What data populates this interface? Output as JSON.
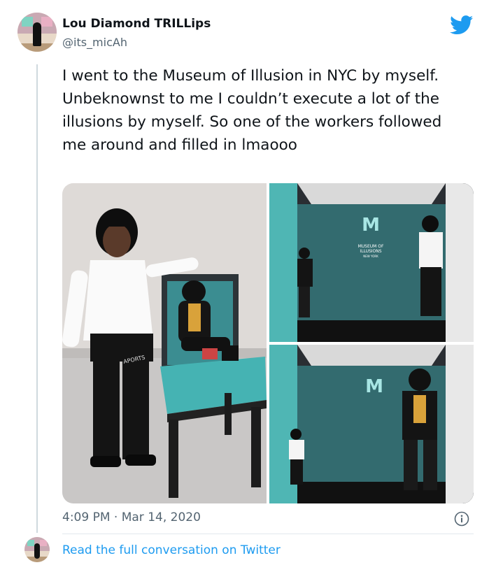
{
  "author": {
    "display_name": "Lou Diamond TRILLips",
    "handle": "@its_micAh"
  },
  "tweet": {
    "text": "I went to the Museum of Illusion in NYC by myself. Unbeknownst to me I couldn’t execute a lot of the illusions by myself. So one of the workers followed me around and filled in lmaooo",
    "time": "4:09 PM",
    "separator": "·",
    "date": "Mar 14, 2020"
  },
  "media": {
    "wall_sign_line1": "MUSEUM OF",
    "wall_sign_line2": "ILLUSIONS",
    "wall_sign_line3": "NEW YORK",
    "fanny_pack_text": "APORTS"
  },
  "icons": {
    "brand": "twitter-bird-icon",
    "info": "info-icon"
  },
  "colors": {
    "brand_blue": "#1d9bf0",
    "secondary_text": "#536471",
    "wall_teal": "#5fc5c2"
  },
  "footer": {
    "read_more_label": "Read the full conversation on Twitter"
  }
}
